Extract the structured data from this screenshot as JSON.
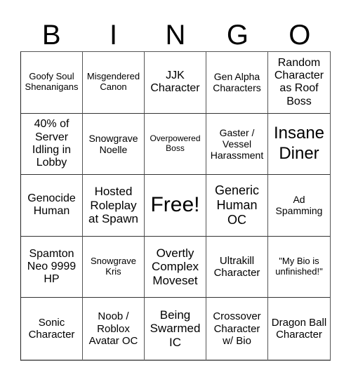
{
  "header": [
    "B",
    "I",
    "N",
    "G",
    "O"
  ],
  "cells": [
    "Goofy Soul Shenanigans",
    "Misgendered Canon",
    "JJK Character",
    "Gen Alpha Characters",
    "Random Character as Roof Boss",
    "40% of Server Idling in Lobby",
    "Snowgrave Noelle",
    "Overpowered Boss",
    "Gaster / Vessel Harassment",
    "Insane Diner",
    "Genocide Human",
    "Hosted Roleplay at Spawn",
    "Free!",
    "Generic Human OC",
    "Ad Spamming",
    "Spamton Neo 9999 HP",
    "Snowgrave Kris",
    "Overtly Complex Moveset",
    "Ultrakill Character",
    "\"My Bio is unfinished!\"",
    "Sonic Character",
    "Noob / Roblox Avatar OC",
    "Being Swarmed IC",
    "Crossover Character w/ Bio",
    "Dragon Ball Character"
  ]
}
